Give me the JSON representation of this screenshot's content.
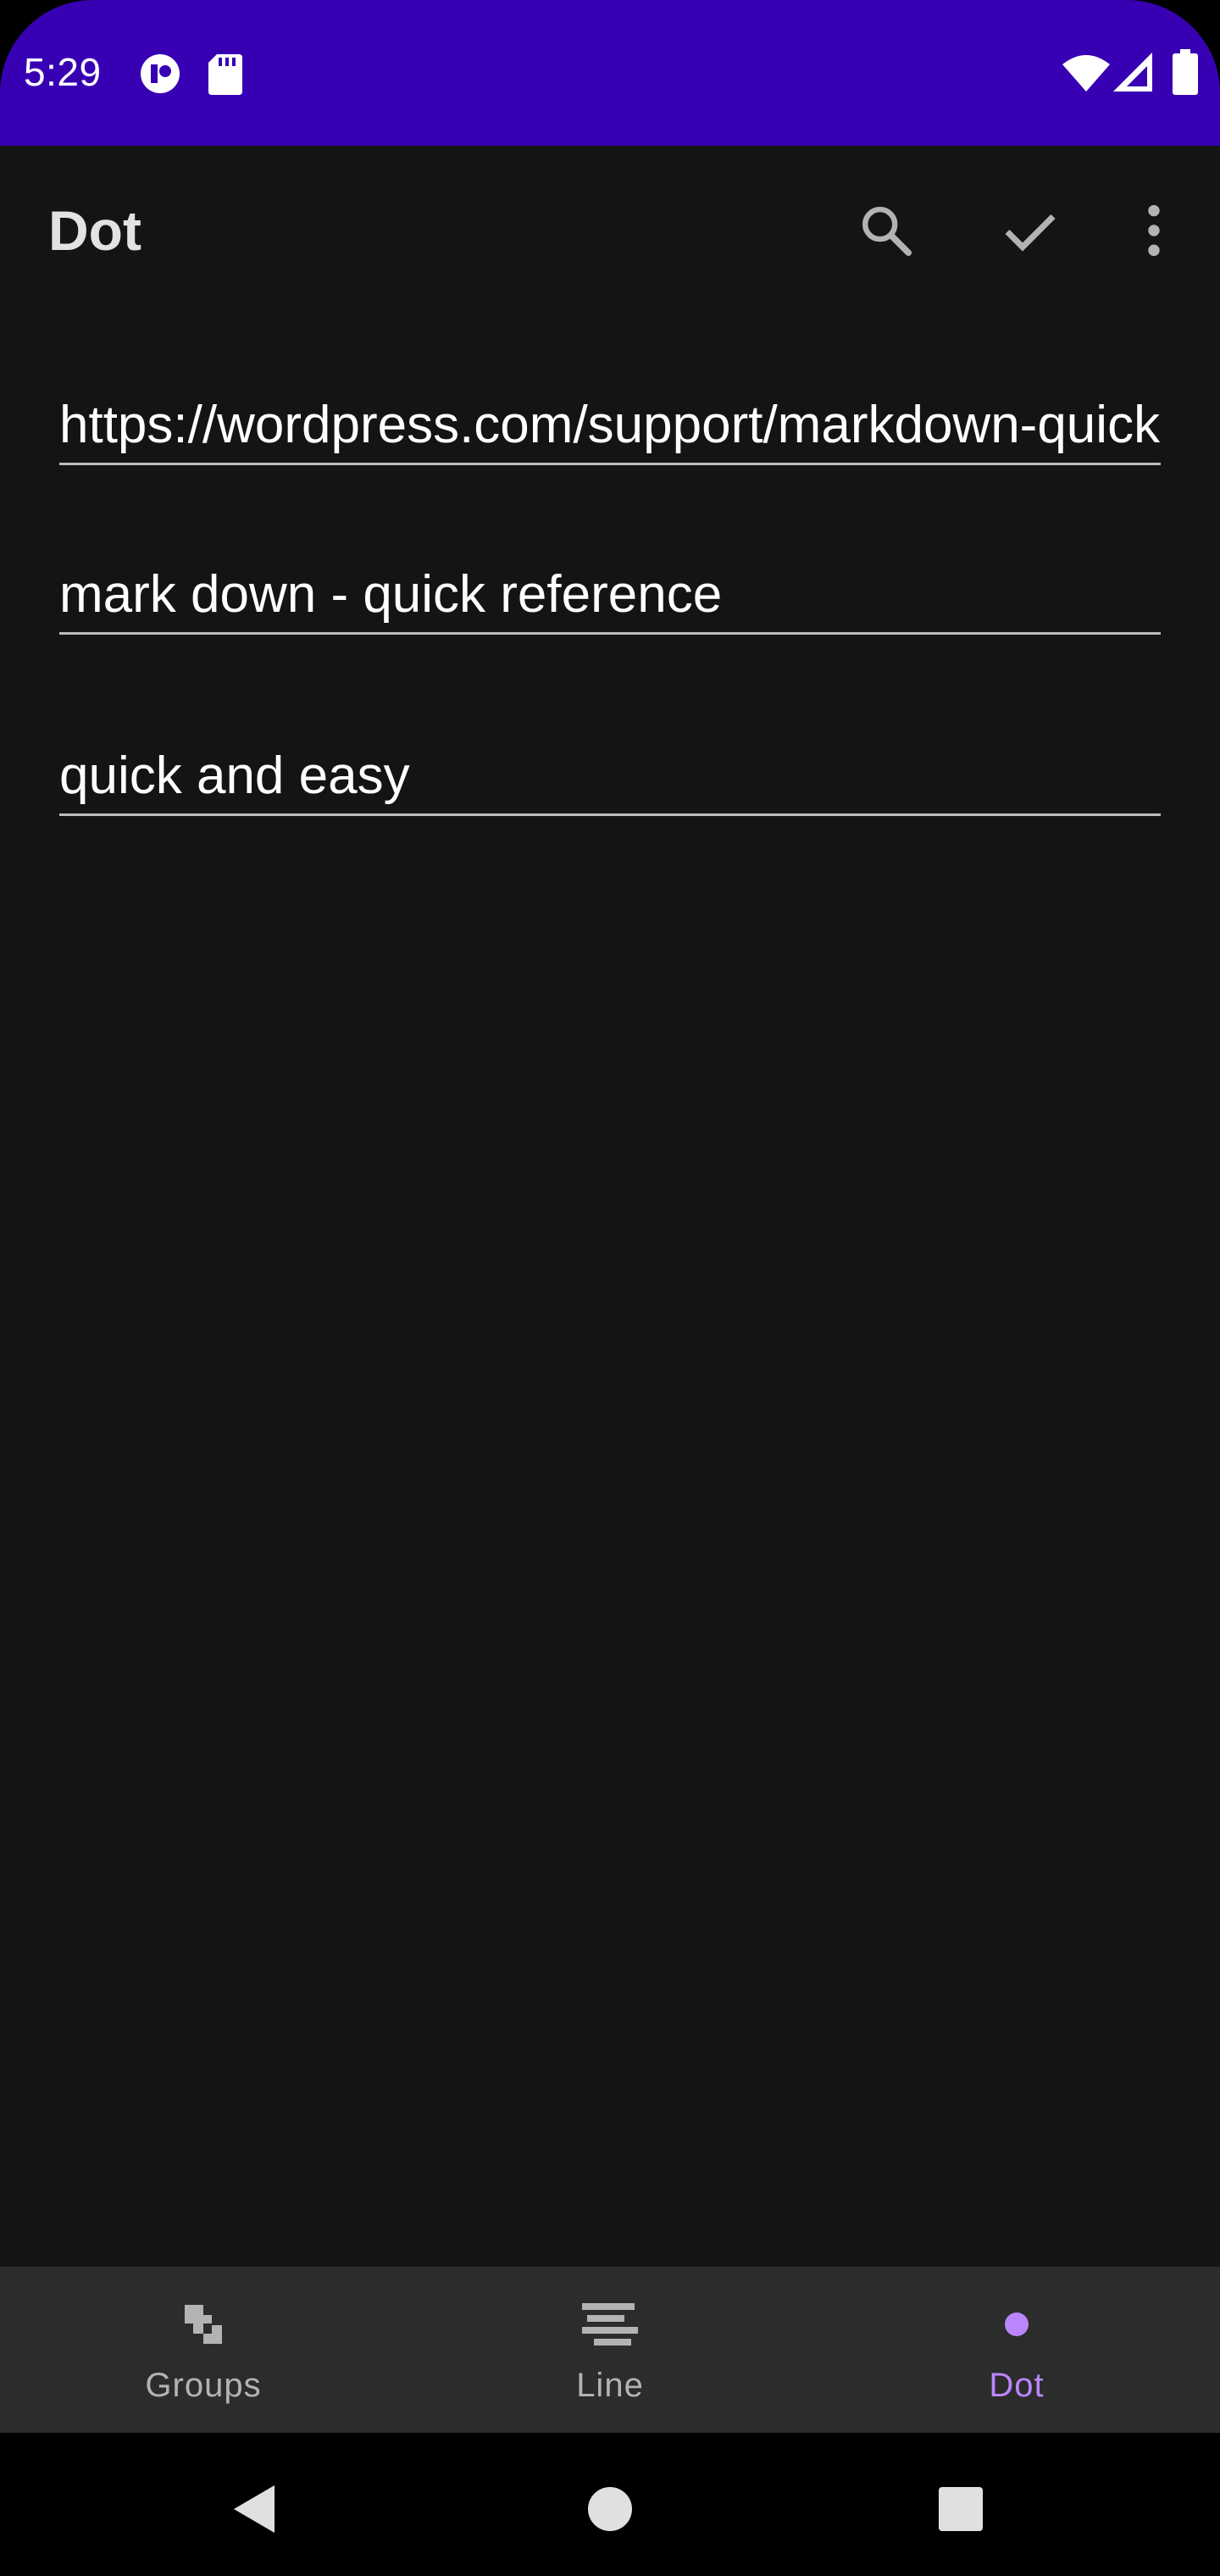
{
  "status_bar": {
    "time": "5:29",
    "background": "#3700b3",
    "icons_left": [
      "app-notification-icon",
      "sd-card-icon"
    ],
    "icons_right": [
      "wifi-icon",
      "cellular-signal-icon",
      "battery-icon"
    ]
  },
  "app_bar": {
    "title": "Dot",
    "actions": [
      "search-icon",
      "check-icon",
      "more-vert-icon"
    ]
  },
  "form": {
    "url_value": "https://wordpress.com/support/markdown-quick-reference/",
    "title_value": "mark down - quick reference",
    "description_value": "quick and easy"
  },
  "bottom_nav": {
    "items": [
      {
        "label": "Groups",
        "icon": "groups-icon",
        "active": false
      },
      {
        "label": "Line",
        "icon": "line-icon",
        "active": false
      },
      {
        "label": "Dot",
        "icon": "dot-icon",
        "active": true
      }
    ],
    "active_color": "#bb86fc",
    "inactive_color": "#b3b3b3"
  },
  "system_nav": {
    "buttons": [
      "back-icon",
      "home-icon",
      "recents-icon"
    ]
  }
}
